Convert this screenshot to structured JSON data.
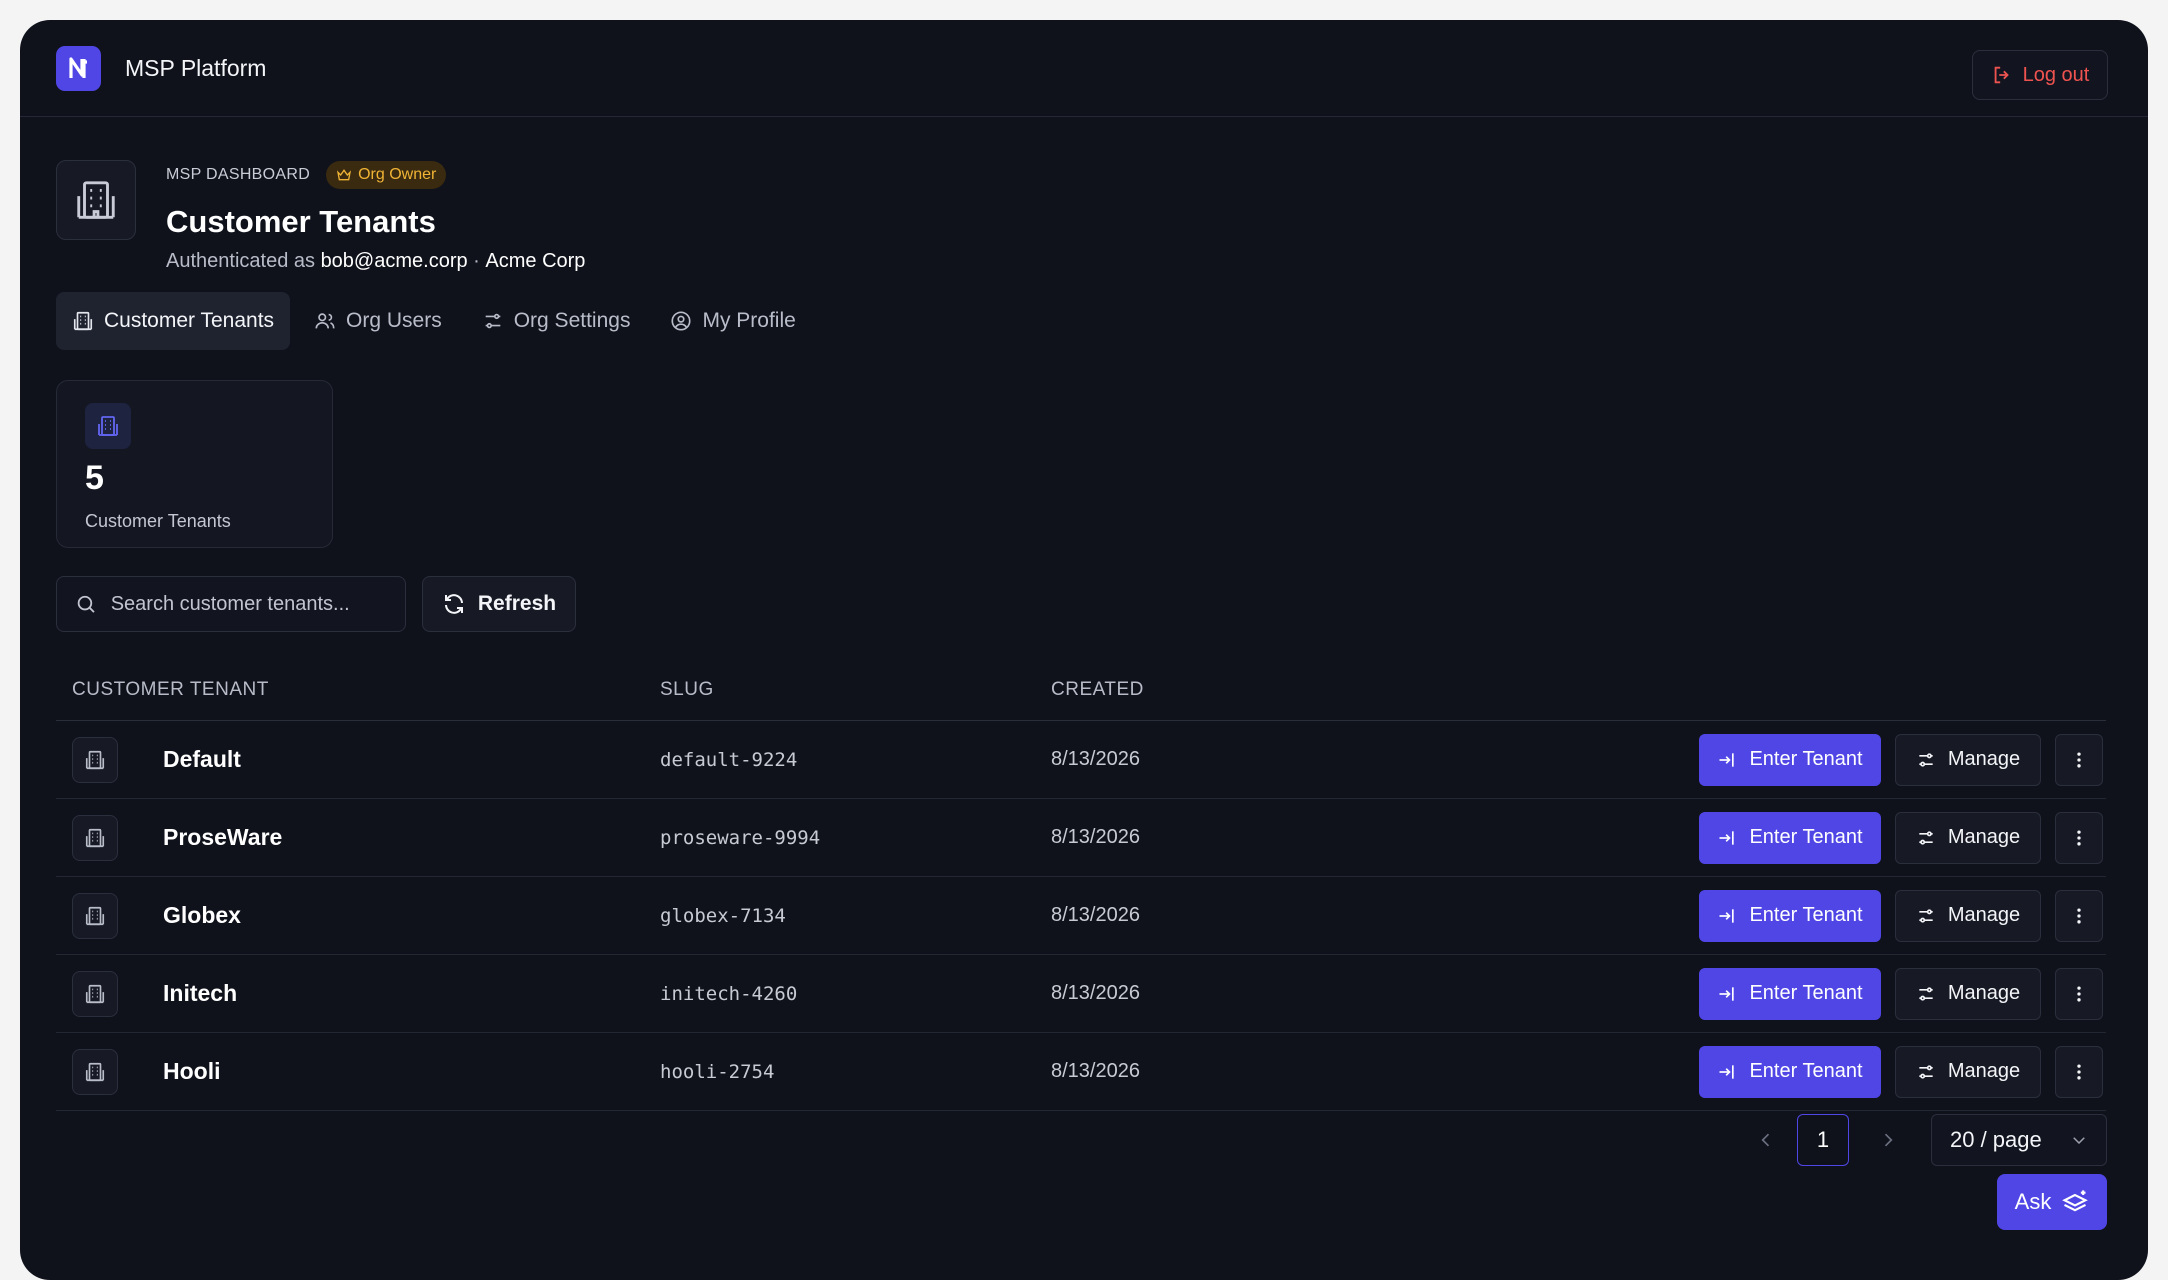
{
  "app": {
    "title": "MSP Platform",
    "logout_label": "Log out"
  },
  "page": {
    "eyebrow": "MSP DASHBOARD",
    "badge": "Org Owner",
    "title": "Customer Tenants",
    "auth_prefix": "Authenticated as",
    "auth_user": "bob@acme.corp",
    "auth_sep": " · ",
    "auth_org": "Acme Corp"
  },
  "tabs": [
    {
      "label": "Customer Tenants",
      "icon": "building-icon",
      "active": true
    },
    {
      "label": "Org Users",
      "icon": "users-icon",
      "active": false
    },
    {
      "label": "Org Settings",
      "icon": "sliders-icon",
      "active": false
    },
    {
      "label": "My Profile",
      "icon": "user-circle-icon",
      "active": false
    }
  ],
  "stat": {
    "value": "5",
    "label": "Customer Tenants"
  },
  "toolbar": {
    "search_placeholder": "Search customer tenants...",
    "refresh_label": "Refresh"
  },
  "table": {
    "headers": {
      "tenant": "CUSTOMER TENANT",
      "slug": "SLUG",
      "created": "CREATED"
    },
    "enter_label": "Enter Tenant",
    "manage_label": "Manage",
    "rows": [
      {
        "name": "Default",
        "slug": "default-9224",
        "created": "8/13/2026"
      },
      {
        "name": "ProseWare",
        "slug": "proseware-9994",
        "created": "8/13/2026"
      },
      {
        "name": "Globex",
        "slug": "globex-7134",
        "created": "8/13/2026"
      },
      {
        "name": "Initech",
        "slug": "initech-4260",
        "created": "8/13/2026"
      },
      {
        "name": "Hooli",
        "slug": "hooli-2754",
        "created": "8/13/2026"
      }
    ]
  },
  "pagination": {
    "current_page": "1",
    "page_size": "20 / page"
  },
  "ask": {
    "label": "Ask"
  },
  "colors": {
    "accent": "#4f46e5",
    "background": "#0f121b",
    "danger": "#ef5350",
    "badge": "#f0b435"
  }
}
